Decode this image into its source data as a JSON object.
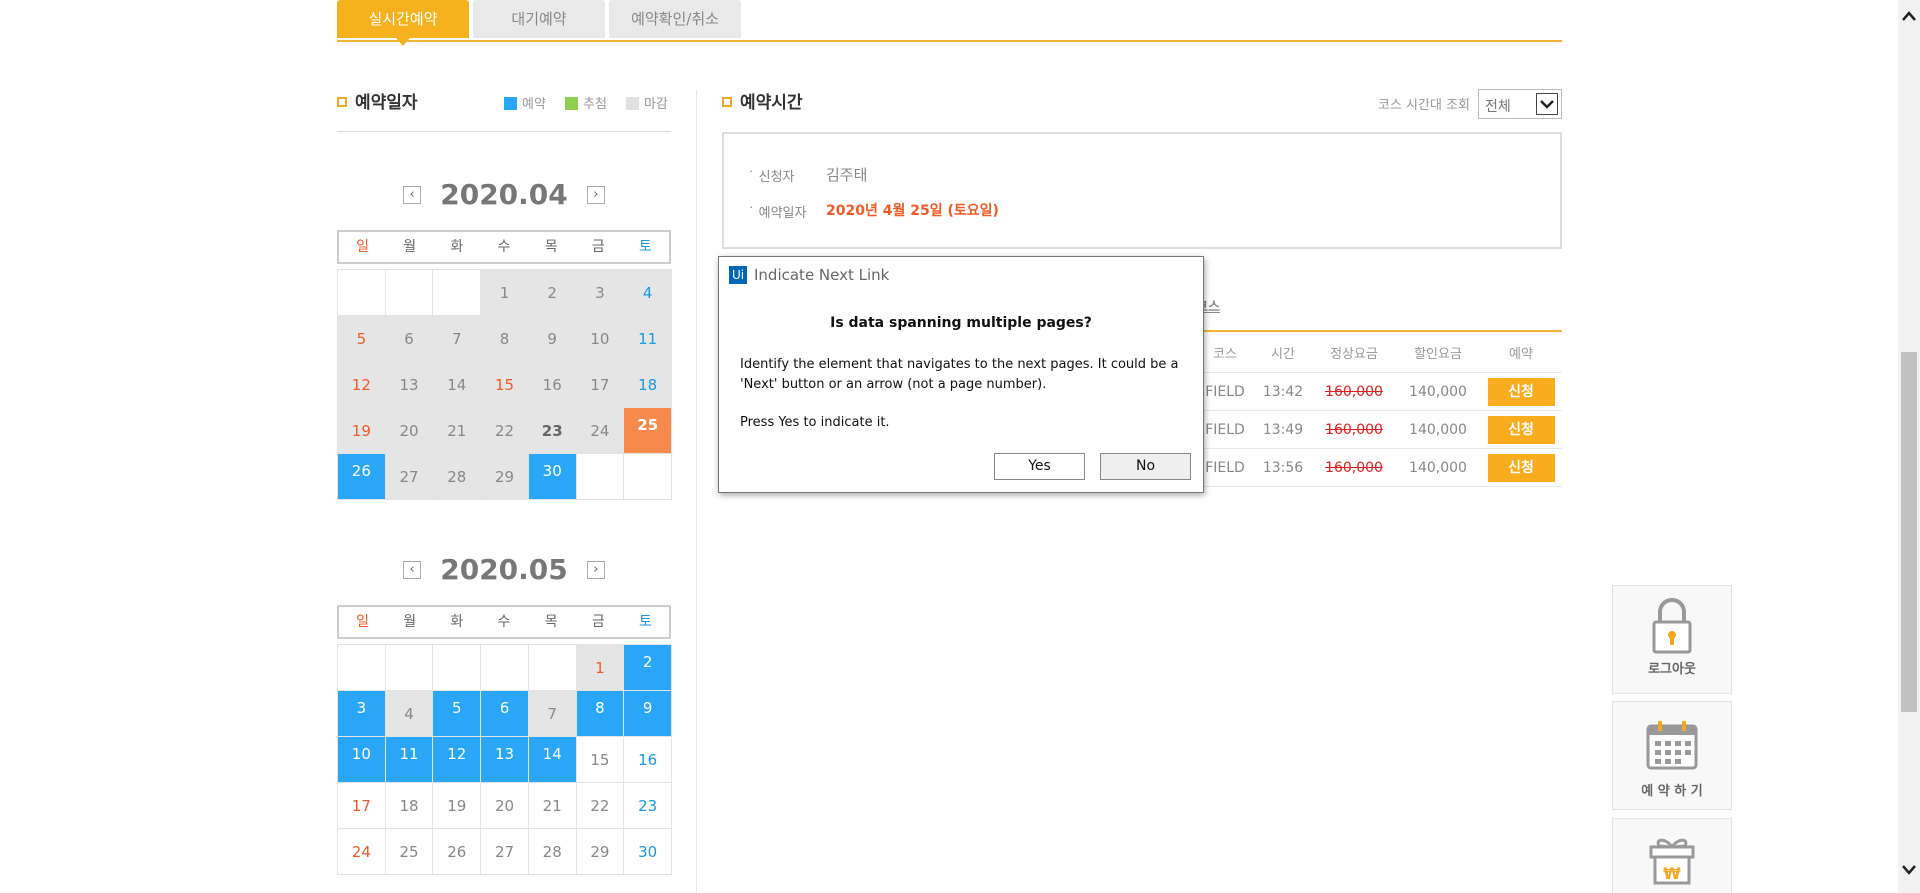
{
  "tabs": [
    "실시간예약",
    "대기예약",
    "예약확인/취소"
  ],
  "date_section": {
    "title": "예약일자",
    "legend": [
      {
        "label": "예약",
        "color": "#2aa6f7"
      },
      {
        "label": "추첨",
        "color": "#8fd14f"
      },
      {
        "label": "마감",
        "color": "#e0e0e0"
      }
    ]
  },
  "calendar_april": {
    "month": "2020.04",
    "weekdays": [
      "일",
      "월",
      "화",
      "수",
      "목",
      "금",
      "토"
    ],
    "cells": [
      {
        "d": "",
        "s": "empty"
      },
      {
        "d": "",
        "s": "empty"
      },
      {
        "d": "",
        "s": "empty"
      },
      {
        "d": "1",
        "s": "closed"
      },
      {
        "d": "2",
        "s": "closed"
      },
      {
        "d": "3",
        "s": "closed"
      },
      {
        "d": "4",
        "s": "closed sat"
      },
      {
        "d": "5",
        "s": "closed sun"
      },
      {
        "d": "6",
        "s": "closed"
      },
      {
        "d": "7",
        "s": "closed"
      },
      {
        "d": "8",
        "s": "closed"
      },
      {
        "d": "9",
        "s": "closed"
      },
      {
        "d": "10",
        "s": "closed"
      },
      {
        "d": "11",
        "s": "closed sat"
      },
      {
        "d": "12",
        "s": "closed sun"
      },
      {
        "d": "13",
        "s": "closed"
      },
      {
        "d": "14",
        "s": "closed"
      },
      {
        "d": "15",
        "s": "closed sun"
      },
      {
        "d": "16",
        "s": "closed"
      },
      {
        "d": "17",
        "s": "closed"
      },
      {
        "d": "18",
        "s": "closed sat"
      },
      {
        "d": "19",
        "s": "closed sun"
      },
      {
        "d": "20",
        "s": "closed"
      },
      {
        "d": "21",
        "s": "closed"
      },
      {
        "d": "22",
        "s": "closed"
      },
      {
        "d": "23",
        "s": "closed bold"
      },
      {
        "d": "24",
        "s": "closed"
      },
      {
        "d": "25",
        "s": "sel"
      },
      {
        "d": "26",
        "s": "res"
      },
      {
        "d": "27",
        "s": "closed"
      },
      {
        "d": "28",
        "s": "closed"
      },
      {
        "d": "29",
        "s": "closed"
      },
      {
        "d": "30",
        "s": "res"
      },
      {
        "d": "",
        "s": "empty"
      },
      {
        "d": "",
        "s": "empty"
      }
    ]
  },
  "calendar_may": {
    "month": "2020.05",
    "weekdays": [
      "일",
      "월",
      "화",
      "수",
      "목",
      "금",
      "토"
    ],
    "cells": [
      {
        "d": "",
        "s": "empty"
      },
      {
        "d": "",
        "s": "empty"
      },
      {
        "d": "",
        "s": "empty"
      },
      {
        "d": "",
        "s": "empty"
      },
      {
        "d": "",
        "s": "empty"
      },
      {
        "d": "1",
        "s": "closed sun"
      },
      {
        "d": "2",
        "s": "res"
      },
      {
        "d": "3",
        "s": "res"
      },
      {
        "d": "4",
        "s": "closed"
      },
      {
        "d": "5",
        "s": "res"
      },
      {
        "d": "6",
        "s": "res"
      },
      {
        "d": "7",
        "s": "closed"
      },
      {
        "d": "8",
        "s": "res"
      },
      {
        "d": "9",
        "s": "res"
      },
      {
        "d": "10",
        "s": "res"
      },
      {
        "d": "11",
        "s": "res"
      },
      {
        "d": "12",
        "s": "res"
      },
      {
        "d": "13",
        "s": "res"
      },
      {
        "d": "14",
        "s": "res"
      },
      {
        "d": "15",
        "s": ""
      },
      {
        "d": "16",
        "s": "sat"
      },
      {
        "d": "17",
        "s": "sun"
      },
      {
        "d": "18",
        "s": ""
      },
      {
        "d": "19",
        "s": ""
      },
      {
        "d": "20",
        "s": ""
      },
      {
        "d": "21",
        "s": ""
      },
      {
        "d": "22",
        "s": ""
      },
      {
        "d": "23",
        "s": "sat"
      },
      {
        "d": "24",
        "s": "sun"
      },
      {
        "d": "25",
        "s": ""
      },
      {
        "d": "26",
        "s": ""
      },
      {
        "d": "27",
        "s": ""
      },
      {
        "d": "28",
        "s": ""
      },
      {
        "d": "29",
        "s": ""
      },
      {
        "d": "30",
        "s": "sat"
      }
    ]
  },
  "time_section": {
    "title": "예약시간",
    "filter_label": "코스 시간대 조회",
    "filter_value": "전체",
    "applicant_label": "신청자",
    "applicant": "김주태",
    "date_label": "예약일자",
    "date_value": "2020년 4월 25일 (토요일)",
    "course_tab_fragment": "코스",
    "columns": [
      "코스",
      "시간",
      "정상요금",
      "할인요금",
      "예약"
    ],
    "rows": [
      {
        "course": "FIELD",
        "time": "13:42",
        "normal": "160,000",
        "discount": "140,000",
        "action": "신청"
      },
      {
        "course": "FIELD",
        "time": "13:49",
        "normal": "160,000",
        "discount": "140,000",
        "action": "신청"
      },
      {
        "course": "FIELD",
        "time": "13:56",
        "normal": "160,000",
        "discount": "140,000",
        "action": "신청"
      }
    ]
  },
  "dialog": {
    "logo": "Ui",
    "title": "Indicate Next Link",
    "question": "Is data spanning multiple pages?",
    "body": "Identify the element that navigates to the next pages. It could be a 'Next' button or an arrow (not a page number).",
    "prompt": "Press Yes to indicate it.",
    "yes": "Yes",
    "no": "No"
  },
  "quick_menu": {
    "logout": "로그아웃",
    "reserve": "예 약 하 기"
  },
  "nav": {
    "prev": "‹",
    "next": "›"
  }
}
